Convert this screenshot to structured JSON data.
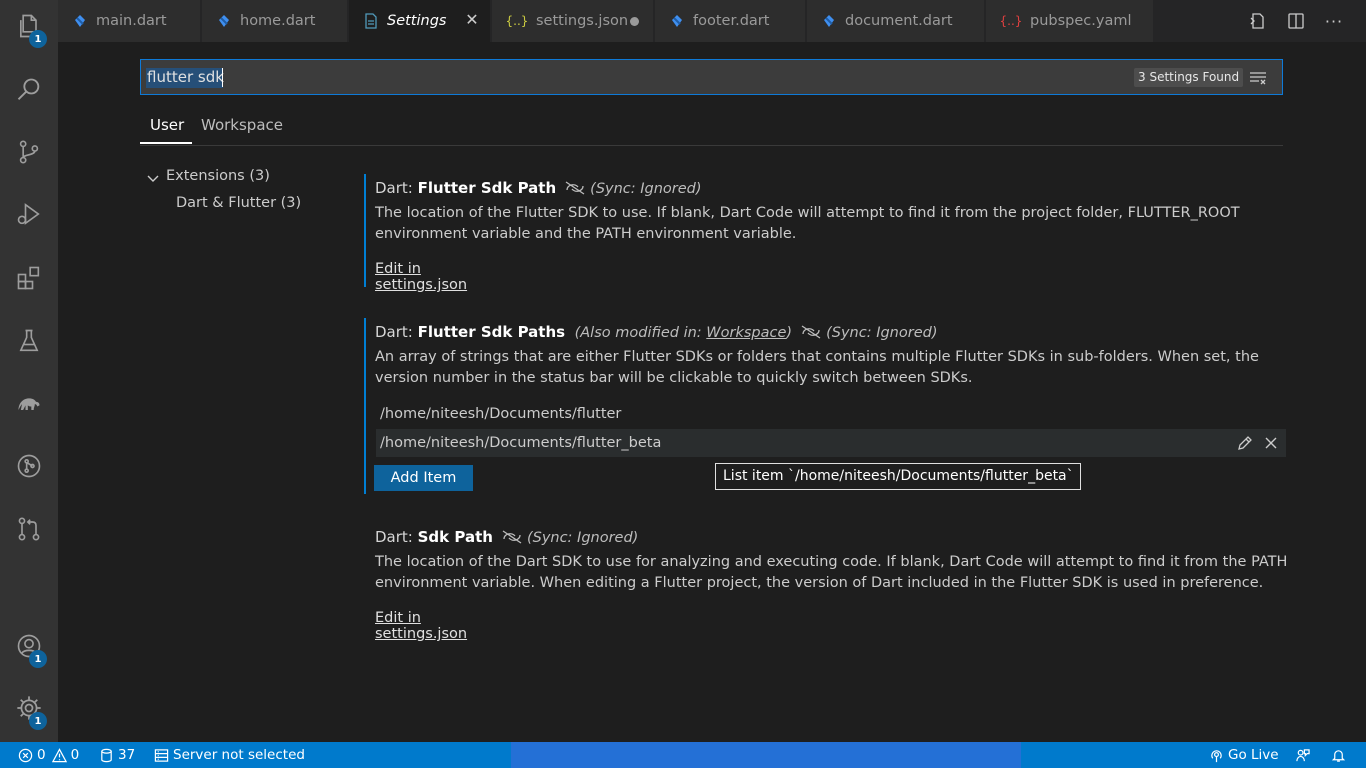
{
  "tabs": [
    {
      "label": "main.dart",
      "icon": "dart-icon"
    },
    {
      "label": "home.dart",
      "icon": "dart-icon"
    },
    {
      "label": "Settings",
      "icon": "settings-file-icon",
      "active": true
    },
    {
      "label": "settings.json",
      "icon": "json-icon",
      "icon_text": "{..}",
      "modified": true
    },
    {
      "label": "footer.dart",
      "icon": "dart-icon"
    },
    {
      "label": "document.dart",
      "icon": "dart-icon"
    },
    {
      "label": "pubspec.yaml",
      "icon": "yaml-icon",
      "icon_text": "{..}"
    }
  ],
  "activity_bar": {
    "explorer_badge": "1",
    "accounts_badge": "1",
    "manage_badge": "1"
  },
  "search": {
    "value": "flutter sdk",
    "results_count": "3 Settings Found"
  },
  "scope_tabs": {
    "user": "User",
    "workspace": "Workspace"
  },
  "toc": {
    "extensions": "Extensions (3)",
    "dart_flutter": "Dart & Flutter (3)"
  },
  "settings": {
    "flutter_sdk_path": {
      "category": "Dart: ",
      "name": "Flutter Sdk Path",
      "sync": "Sync: Ignored)",
      "sync_open": "(",
      "description": "The location of the Flutter SDK to use. If blank, Dart Code will attempt to find it from the project folder, FLUTTER_ROOT environment variable and the PATH environment variable.",
      "edit_link": "Edit in settings.json"
    },
    "flutter_sdk_paths": {
      "category": "Dart: ",
      "name": "Flutter Sdk Paths",
      "modified_prefix": "(Also modified in: ",
      "modified_link": "Workspace",
      "modified_suffix": ")",
      "sync": "Sync: Ignored)",
      "sync_open": "(",
      "description": "An array of strings that are either Flutter SDKs or folders that contains multiple Flutter SDKs in sub-folders. When set, the version number in the status bar will be clickable to quickly switch between SDKs.",
      "items": [
        "/home/niteesh/Documents/flutter",
        "/home/niteesh/Documents/flutter_beta"
      ],
      "add_item": "Add Item",
      "tooltip": "List item `/home/niteesh/Documents/flutter_beta`"
    },
    "sdk_path": {
      "category": "Dart: ",
      "name": "Sdk Path",
      "sync": "Sync: Ignored)",
      "sync_open": "(",
      "description": "The location of the Dart SDK to use for analyzing and executing code. If blank, Dart Code will attempt to find it from the PATH environment variable. When editing a Flutter project, the version of Dart included in the Flutter SDK is used in preference.",
      "edit_link": "Edit in settings.json"
    }
  },
  "statusbar": {
    "errors": "0",
    "warnings": "0",
    "db_count": "37",
    "server": "Server not selected",
    "go_live": "Go Live"
  },
  "colors": {
    "accent": "#007acc",
    "button": "#0e639c",
    "dart": "#3f8ff0"
  }
}
